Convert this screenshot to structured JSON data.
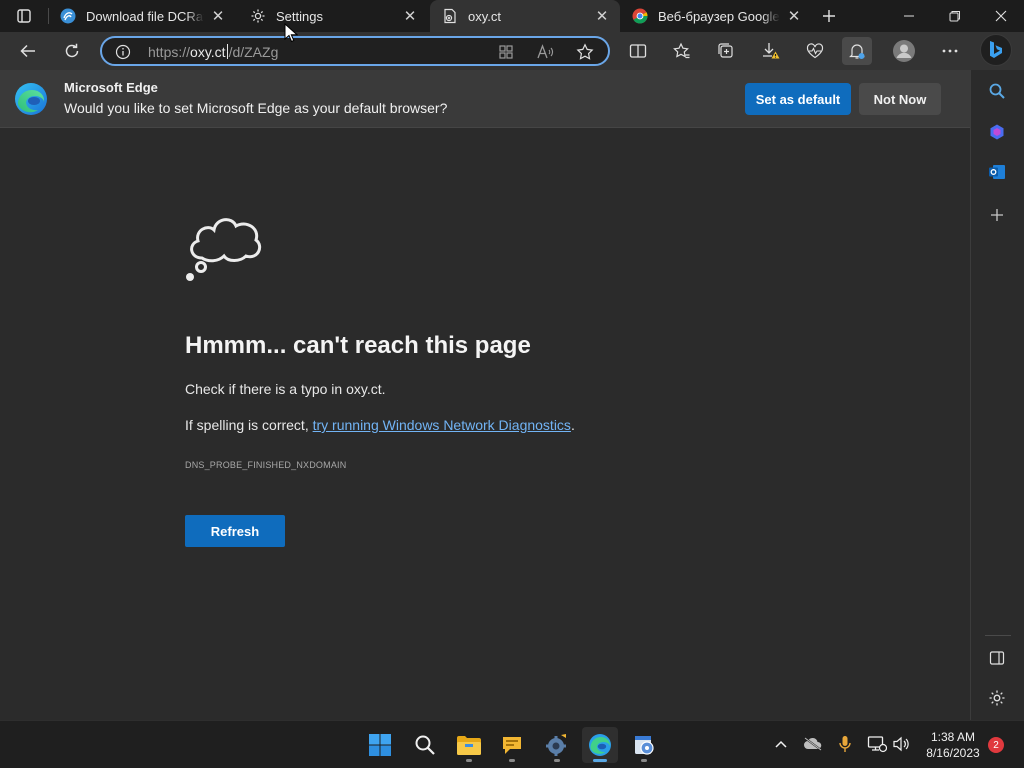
{
  "tabs": [
    {
      "title": "Download file DCRatBuild",
      "icon": "downloader-icon"
    },
    {
      "title": "Settings",
      "icon": "gear-icon"
    },
    {
      "title": "oxy.ct",
      "icon": "error-page-icon",
      "active": true
    },
    {
      "title": "Веб-браузер Google Chrome",
      "icon": "chrome-icon"
    }
  ],
  "address": {
    "scheme": "https://",
    "host": "oxy.ct",
    "path": "/d/ZAZg"
  },
  "banner": {
    "title": "Microsoft Edge",
    "text": "Would you like to set Microsoft Edge as your default browser?",
    "primary": "Set as default",
    "secondary": "Not Now"
  },
  "error": {
    "title": "Hmmm... can't reach this page",
    "line1": "Check if there is a typo in oxy.ct.",
    "line2_prefix": "If spelling is correct, ",
    "line2_link": "try running Windows Network Diagnostics",
    "line2_suffix": ".",
    "code": "DNS_PROBE_FINISHED_NXDOMAIN",
    "button": "Refresh"
  },
  "taskbar": {
    "time": "1:38 AM",
    "date": "8/16/2023",
    "notifications": "2"
  },
  "colors": {
    "accent": "#0f6cbd",
    "link": "#72b4f5",
    "background": "#2b2b2b"
  }
}
